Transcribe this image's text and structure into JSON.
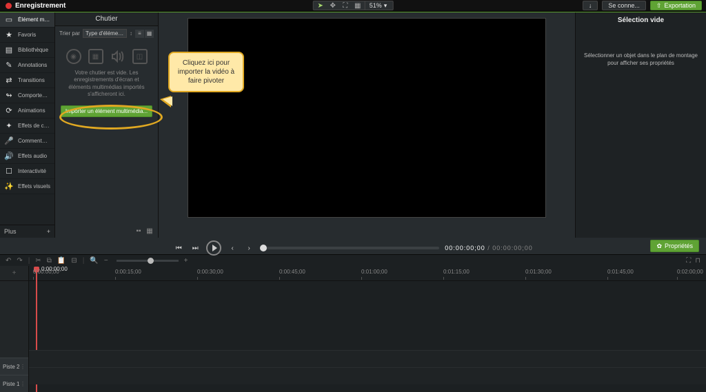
{
  "topbar": {
    "record": "Enregistrement",
    "zoom": "51%",
    "download_icon": "↓",
    "signin": "Se conne...",
    "export": "Exportation"
  },
  "sidebar": {
    "items": [
      {
        "icon": "▭",
        "label": "Élément multim..."
      },
      {
        "icon": "★",
        "label": "Favoris"
      },
      {
        "icon": "▤",
        "label": "Bibliothèque"
      },
      {
        "icon": "✎",
        "label": "Annotations"
      },
      {
        "icon": "⇄",
        "label": "Transitions"
      },
      {
        "icon": "↬",
        "label": "Comportements"
      },
      {
        "icon": "⟳",
        "label": "Animations"
      },
      {
        "icon": "✦",
        "label": "Effets de curseur"
      },
      {
        "icon": "🎤",
        "label": "Commentaires..."
      },
      {
        "icon": "🔊",
        "label": "Effets audio"
      },
      {
        "icon": "☐",
        "label": "Interactivité"
      },
      {
        "icon": "✨",
        "label": "Effets visuels"
      }
    ],
    "more": "Plus",
    "add": "+"
  },
  "mediabin": {
    "title": "Chutier",
    "sort_label": "Trier par",
    "sort_value": "Type d'élément mult...",
    "empty_msg": "Votre chutier est vide. Les enregistrements d'écran et éléments multimédias importés s'afficheront ici.",
    "import_btn": "Importer un élément multimédia..."
  },
  "canvas": {
    "time_current": "00:00:00;00",
    "time_total": "00:00:00;00",
    "sep": " / "
  },
  "properties": {
    "title": "Sélection vide",
    "msg": "Sélectionner un objet dans le plan de montage pour afficher ses propriétés",
    "btn": "Propriétés"
  },
  "timeline": {
    "playhead": "0:00:00;00",
    "ticks": [
      "0:00:00;00",
      "0:00:15;00",
      "0:00:30;00",
      "0:00:45;00",
      "0:01:00;00",
      "0:01:15;00",
      "0:01:30;00",
      "0:01:45;00",
      "0:02:00;00"
    ],
    "tracks": [
      "Piste 2",
      "Piste 1"
    ]
  },
  "bubble": "Cliquez ici pour importer la vidéo à faire pivoter"
}
